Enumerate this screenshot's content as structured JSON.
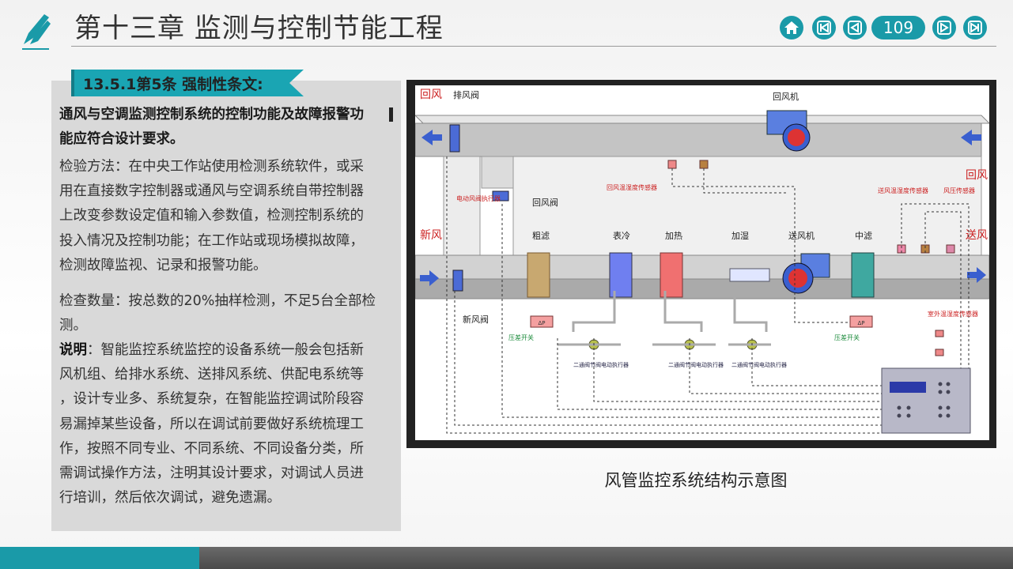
{
  "header": {
    "title": "第十三章 监测与控制节能工程",
    "page_number": "109",
    "accent_color": "#1a9aa8"
  },
  "nav": {
    "home_icon": "home-icon",
    "first_icon": "first-page-icon",
    "prev_icon": "prev-page-icon",
    "next_icon": "next-page-icon",
    "last_icon": "last-page-icon"
  },
  "article": {
    "tag": "13.5.1第5条 强制性条文:",
    "paragraphs": [
      {
        "style": "bold",
        "lines": [
          "通风与空调监测控制系统的控制功能及故障报警功",
          "能应符合设计要求。"
        ]
      },
      {
        "style": "normal",
        "lines": [
          "检验方法：在中央工作站使用检测系统软件，或采",
          "用在直接数字控制器或通风与空调系统自带控制器",
          "上改变参数设定值和输入参数值，检测控制系统的",
          "投入情况及控制功能；在工作站或现场模拟故障，",
          "检测故障监视、记录和报警功能。"
        ]
      },
      {
        "style": "normal",
        "lines": [
          "检查数量：按总数的20%抽样检测，不足5台全部检",
          "测。"
        ]
      },
      {
        "style": "note",
        "lead": "说明",
        "lines": [
          "：智能监控系统监控的设备系统一般会包括新",
          "风机组、给排水系统、送排风系统、供配电系统等",
          "，设计专业多、系统复杂，在智能监控调试阶段容",
          "易漏掉某些设备，所以在调试前要做好系统梳理工",
          "作，按照不同专业、不同系统、不同设备分类，所",
          "需调试操作方法，注明其设计要求，对调试人员进",
          "行培训，然后依次调试，避免遗漏。"
        ]
      }
    ]
  },
  "diagram": {
    "caption": "风管监控系统结构示意图",
    "labels": {
      "return_air": "回风",
      "exhaust_damper": "排风阀",
      "return_fan": "回风机",
      "return_air_right": "回风",
      "return_temp_sensor": "回风温湿度传感器",
      "supply_temp_sensor": "送风温湿度传感器",
      "pressure_sensor": "风压传感器",
      "damper_actuator": "电动风阀执行器",
      "return_damper": "回风阀",
      "fresh_air": "新风",
      "coarse_filter": "粗滤",
      "cooling": "表冷",
      "heating": "加热",
      "humidify": "加湿",
      "supply_fan": "送风机",
      "medium_filter": "中滤",
      "supply_air": "送风",
      "fresh_damper": "新风阀",
      "diff_switch_1": "压差开关",
      "diff_switch_2": "压差开关",
      "outdoor_sensor": "室外温湿度传感器",
      "valve_1": "二通阀节阀电动执行器",
      "valve_2": "二通阀节阀电动执行器",
      "valve_3": "二通阀节阀电动执行器",
      "dp": "ΔP"
    }
  }
}
